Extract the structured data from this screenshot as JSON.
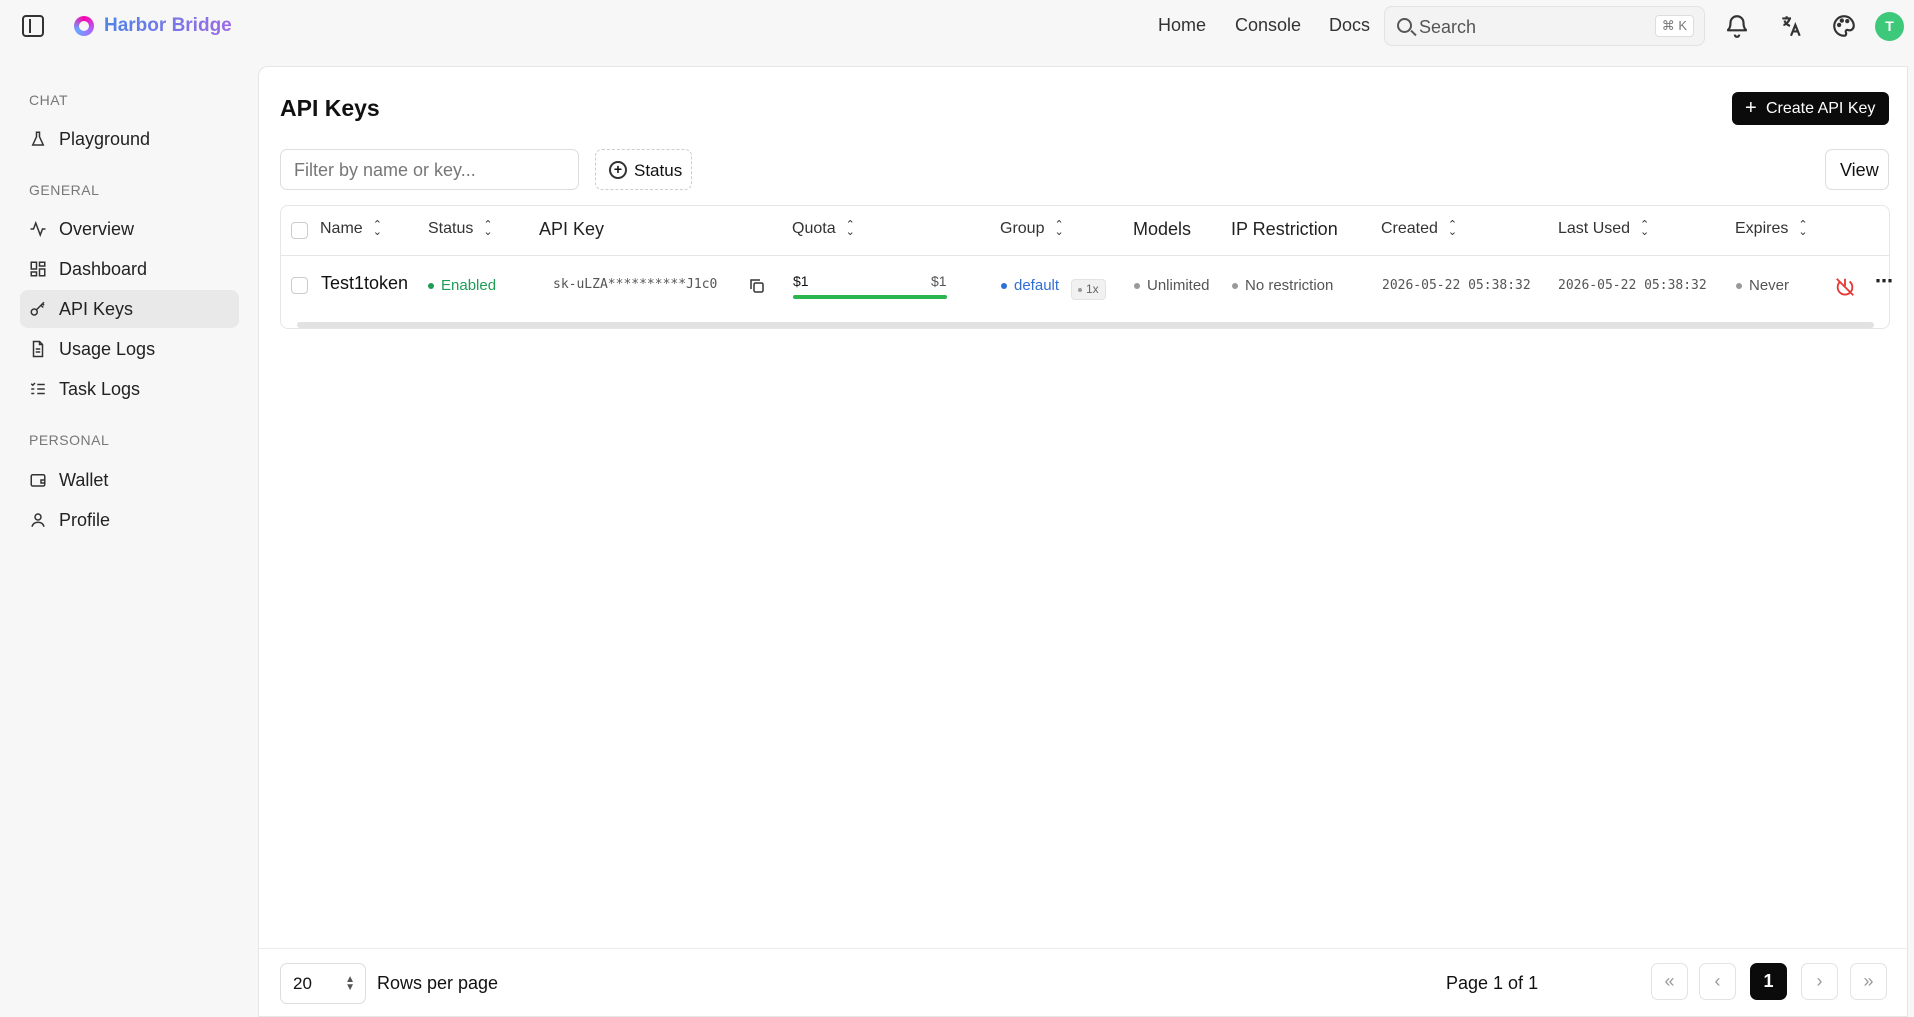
{
  "app": {
    "name": "Harbor Bridge"
  },
  "topnav": {
    "home": "Home",
    "console": "Console",
    "docs": "Docs"
  },
  "search": {
    "placeholder": "Search",
    "shortcut": "⌘ K"
  },
  "user": {
    "initial": "T",
    "avatar_color": "#3ec87a"
  },
  "sidebar": {
    "sections": [
      {
        "label": "CHAT",
        "items": [
          {
            "label": "Playground",
            "icon": "flask-icon"
          }
        ]
      },
      {
        "label": "GENERAL",
        "items": [
          {
            "label": "Overview",
            "icon": "activity-icon"
          },
          {
            "label": "Dashboard",
            "icon": "dashboard-icon"
          },
          {
            "label": "API Keys",
            "icon": "key-icon",
            "active": true
          },
          {
            "label": "Usage Logs",
            "icon": "document-icon"
          },
          {
            "label": "Task Logs",
            "icon": "list-check-icon"
          }
        ]
      },
      {
        "label": "PERSONAL",
        "items": [
          {
            "label": "Wallet",
            "icon": "wallet-icon"
          },
          {
            "label": "Profile",
            "icon": "user-icon"
          }
        ]
      }
    ]
  },
  "page": {
    "title": "API Keys",
    "create_label": "Create API Key",
    "filter_placeholder": "Filter by name or key...",
    "status_filter": "Status",
    "view_label": "View"
  },
  "table": {
    "columns": [
      "Name",
      "Status",
      "API Key",
      "Quota",
      "Group",
      "Models",
      "IP Restriction",
      "Created",
      "Last Used",
      "Expires"
    ],
    "rows": [
      {
        "name": "Test1token",
        "status": "Enabled",
        "api_key": "sk-uLZA**********J1c0",
        "quota_used": "$1",
        "quota_total": "$1",
        "quota_fraction": 1.0,
        "group": "default",
        "ratio": "1x",
        "models": "Unlimited",
        "ip_restriction": "No restriction",
        "created": "2026-05-22 05:38:32",
        "last_used": "2026-05-22 05:38:32",
        "expires": "Never"
      }
    ]
  },
  "pagination": {
    "rows_per_page": "20",
    "rows_label": "Rows per page",
    "page_info": "Page 1 of 1",
    "current_page": "1"
  },
  "colors": {
    "enabled": "#1f9d55",
    "group": "#2f6fd6",
    "disable": "#e53935",
    "accent": "#0b0b0b"
  }
}
